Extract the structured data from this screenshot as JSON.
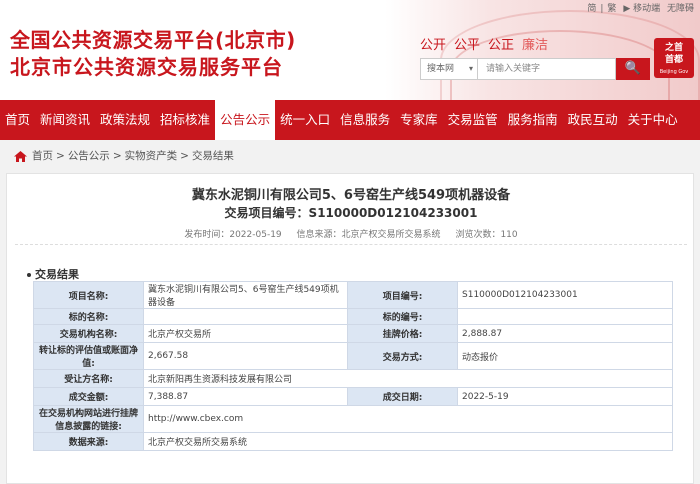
{
  "header": {
    "title_line1": "全国公共资源交易平台(北京市)",
    "title_line2": "北京市公共资源交易服务平台",
    "top_links": [
      "简",
      "|",
      "繁",
      "▶ 移动端",
      "无障碍"
    ],
    "slogans": [
      "公开",
      "公平",
      "公正",
      "廉洁"
    ],
    "logo_text": [
      "之首",
      "首都"
    ],
    "logo_sub": "Beijing Gov",
    "search": {
      "select": "搜本网",
      "placeholder": "请输入关键字",
      "button": "🔍"
    }
  },
  "nav": {
    "items": [
      "首页",
      "新闻资讯",
      "政策法规",
      "招标核准",
      "公告公示",
      "统一入口",
      "信息服务",
      "专家库",
      "交易监管",
      "服务指南",
      "政民互动",
      "关于中心"
    ],
    "active_index": 4
  },
  "breadcrumb": {
    "items": [
      "首页",
      "公告公示",
      "实物资产类",
      "交易结果"
    ],
    "separator": ">"
  },
  "article": {
    "title": "冀东水泥铜川有限公司5、6号窑生产线549项机器设备",
    "code_line": "交易项目编号：S110000D012104233001",
    "publish": "发布时间：2022-05-19",
    "source": "信息来源：北京产权交易所交易系统",
    "views": "浏览次数：110",
    "section": "交易结果"
  },
  "table": {
    "rows": [
      [
        "项目名称:",
        "冀东水泥铜川有限公司5、6号窑生产线549项机器设备",
        "项目编号:",
        "S110000D012104233001"
      ],
      [
        "标的名称:",
        "",
        "标的编号:",
        ""
      ],
      [
        "交易机构名称:",
        "北京产权交易所",
        "挂牌价格:",
        "2,888.87"
      ],
      [
        "转让标的评估值或账面净值:",
        "2,667.58",
        "交易方式:",
        "动态报价"
      ],
      [
        "受让方名称:",
        "北京新阳再生资源科技发展有限公司"
      ],
      [
        "成交金额:",
        "7,388.87",
        "成交日期:",
        "2022-5-19"
      ],
      [
        "在交易机构网站进行挂牌信息披露的链接:",
        "http://www.cbex.com"
      ],
      [
        "数据来源:",
        "北京产权交易所交易系统"
      ]
    ]
  }
}
